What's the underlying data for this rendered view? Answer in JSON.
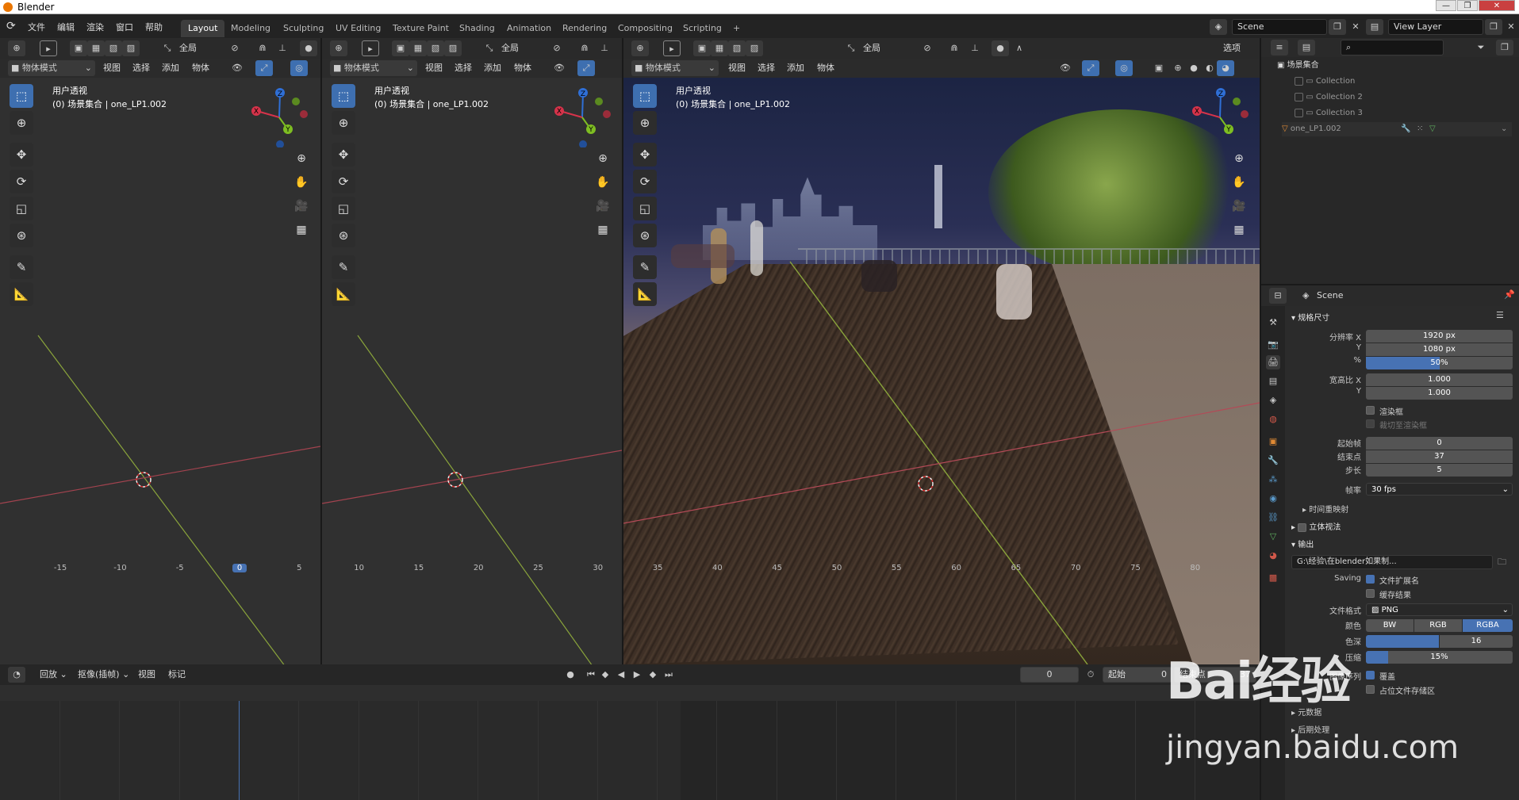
{
  "app": {
    "title": "Blender"
  },
  "menus": [
    "文件",
    "编辑",
    "渲染",
    "窗口",
    "帮助"
  ],
  "workspaces": [
    {
      "label": "Layout",
      "active": true
    },
    {
      "label": "Modeling"
    },
    {
      "label": "Sculpting"
    },
    {
      "label": "UV Editing"
    },
    {
      "label": "Texture Paint"
    },
    {
      "label": "Shading"
    },
    {
      "label": "Animation"
    },
    {
      "label": "Rendering"
    },
    {
      "label": "Compositing"
    },
    {
      "label": "Scripting"
    }
  ],
  "add_workspace": "+",
  "scene": {
    "name": "Scene",
    "view_layer": "View Layer"
  },
  "window_buttons": [
    "—",
    "❐",
    "✕"
  ],
  "viewport": {
    "global_label": "全局",
    "mode": "物体模式",
    "menu": [
      "视图",
      "选择",
      "添加",
      "物体"
    ],
    "info_line1": "用户透视",
    "info_line2": "(0) 场景集合 | one_LP1.002",
    "options_label": "选项"
  },
  "gizmo": {
    "x": "X",
    "y": "Y",
    "z": "Z"
  },
  "outliner": {
    "root": "场景集合",
    "items": [
      "Collection",
      "Collection 2",
      "Collection 3",
      "one_LP1.002"
    ]
  },
  "properties": {
    "scene_label": "Scene",
    "format_section": "规格尺寸",
    "res_x_label": "分辨率 X",
    "res_x": "1920 px",
    "res_y_label": "Y",
    "res_y": "1080 px",
    "res_pct_label": "%",
    "res_pct": "50%",
    "res_pct_value": 0.5,
    "aspect_x_label": "宽高比 X",
    "aspect_x": "1.000",
    "aspect_y_label": "Y",
    "aspect_y": "1.000",
    "border_label": "渲染框",
    "crop_label": "裁切至渲染框",
    "frame_start_label": "起始帧",
    "frame_start": "0",
    "frame_end_label": "结束点",
    "frame_end": "37",
    "frame_step_label": "步长",
    "frame_step": "5",
    "fps_label": "帧率",
    "fps": "30 fps",
    "time_remap": "时间重映射",
    "stereo": "立体视法",
    "output_section": "输出",
    "output_path": "G:\\经验\\在blender如果制...",
    "saving_label": "Saving",
    "file_ext_label": "文件扩展名",
    "cache_label": "缓存结果",
    "file_format_label": "文件格式",
    "file_format": "PNG",
    "color_label": "颜色",
    "color_modes": [
      "BW",
      "RGB",
      "RGBA"
    ],
    "depth_label": "色深",
    "depth": "16",
    "compression_label": "压缩",
    "compression": "15%",
    "compression_value": 0.15,
    "sequence_label": "图像序列",
    "overwrite_label": "覆盖",
    "placeholders_label": "占位文件存储区",
    "metadata": "元数据",
    "postprocess": "后期处理"
  },
  "timeline": {
    "menus": [
      "回放",
      "抠像(插帧)",
      "视图",
      "标记"
    ],
    "current_frame": "0",
    "start_label": "起始",
    "start": "0",
    "end_label": "结束点",
    "end": "37",
    "ticks": [
      "-15",
      "-10",
      "-5",
      "0",
      "5",
      "10",
      "15",
      "20",
      "25",
      "30",
      "35",
      "40",
      "45",
      "50",
      "55",
      "60",
      "65",
      "70",
      "75",
      "80",
      "85"
    ]
  },
  "watermark": {
    "text": "Bai经验",
    "sub": "jingyan.baidu.com"
  }
}
